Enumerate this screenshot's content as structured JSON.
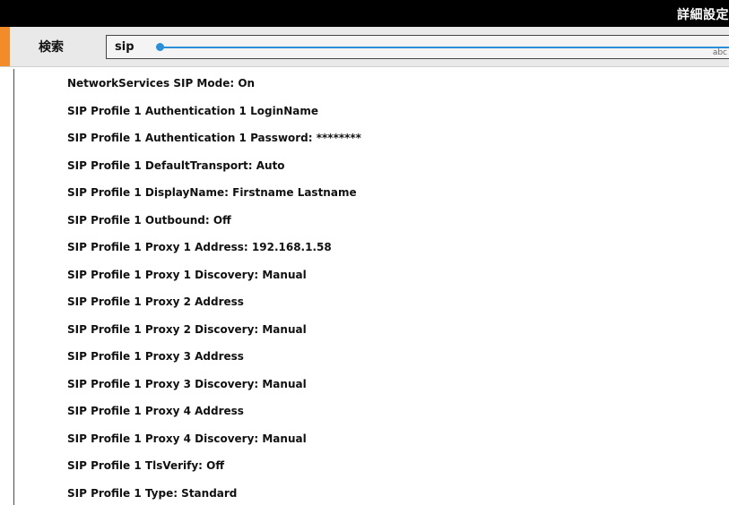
{
  "window": {
    "title": "詳細設定"
  },
  "search": {
    "label": "検索",
    "value": "sip",
    "keyboard_hint": "abc"
  },
  "colors": {
    "accent": "#f28c28",
    "slider": "#2a8fd8"
  },
  "results": [
    "NetworkServices SIP Mode: On",
    "SIP Profile 1 Authentication 1 LoginName",
    "SIP Profile 1 Authentication 1 Password: ********",
    "SIP Profile 1 DefaultTransport: Auto",
    "SIP Profile 1 DisplayName: Firstname Lastname",
    "SIP Profile 1 Outbound: Off",
    "SIP Profile 1 Proxy 1 Address: 192.168.1.58",
    "SIP Profile 1 Proxy 1 Discovery: Manual",
    "SIP Profile 1 Proxy 2 Address",
    "SIP Profile 1 Proxy 2 Discovery: Manual",
    "SIP Profile 1 Proxy 3 Address",
    "SIP Profile 1 Proxy 3 Discovery: Manual",
    "SIP Profile 1 Proxy 4 Address",
    "SIP Profile 1 Proxy 4 Discovery: Manual",
    "SIP Profile 1 TlsVerify: Off",
    "SIP Profile 1 Type: Standard"
  ]
}
